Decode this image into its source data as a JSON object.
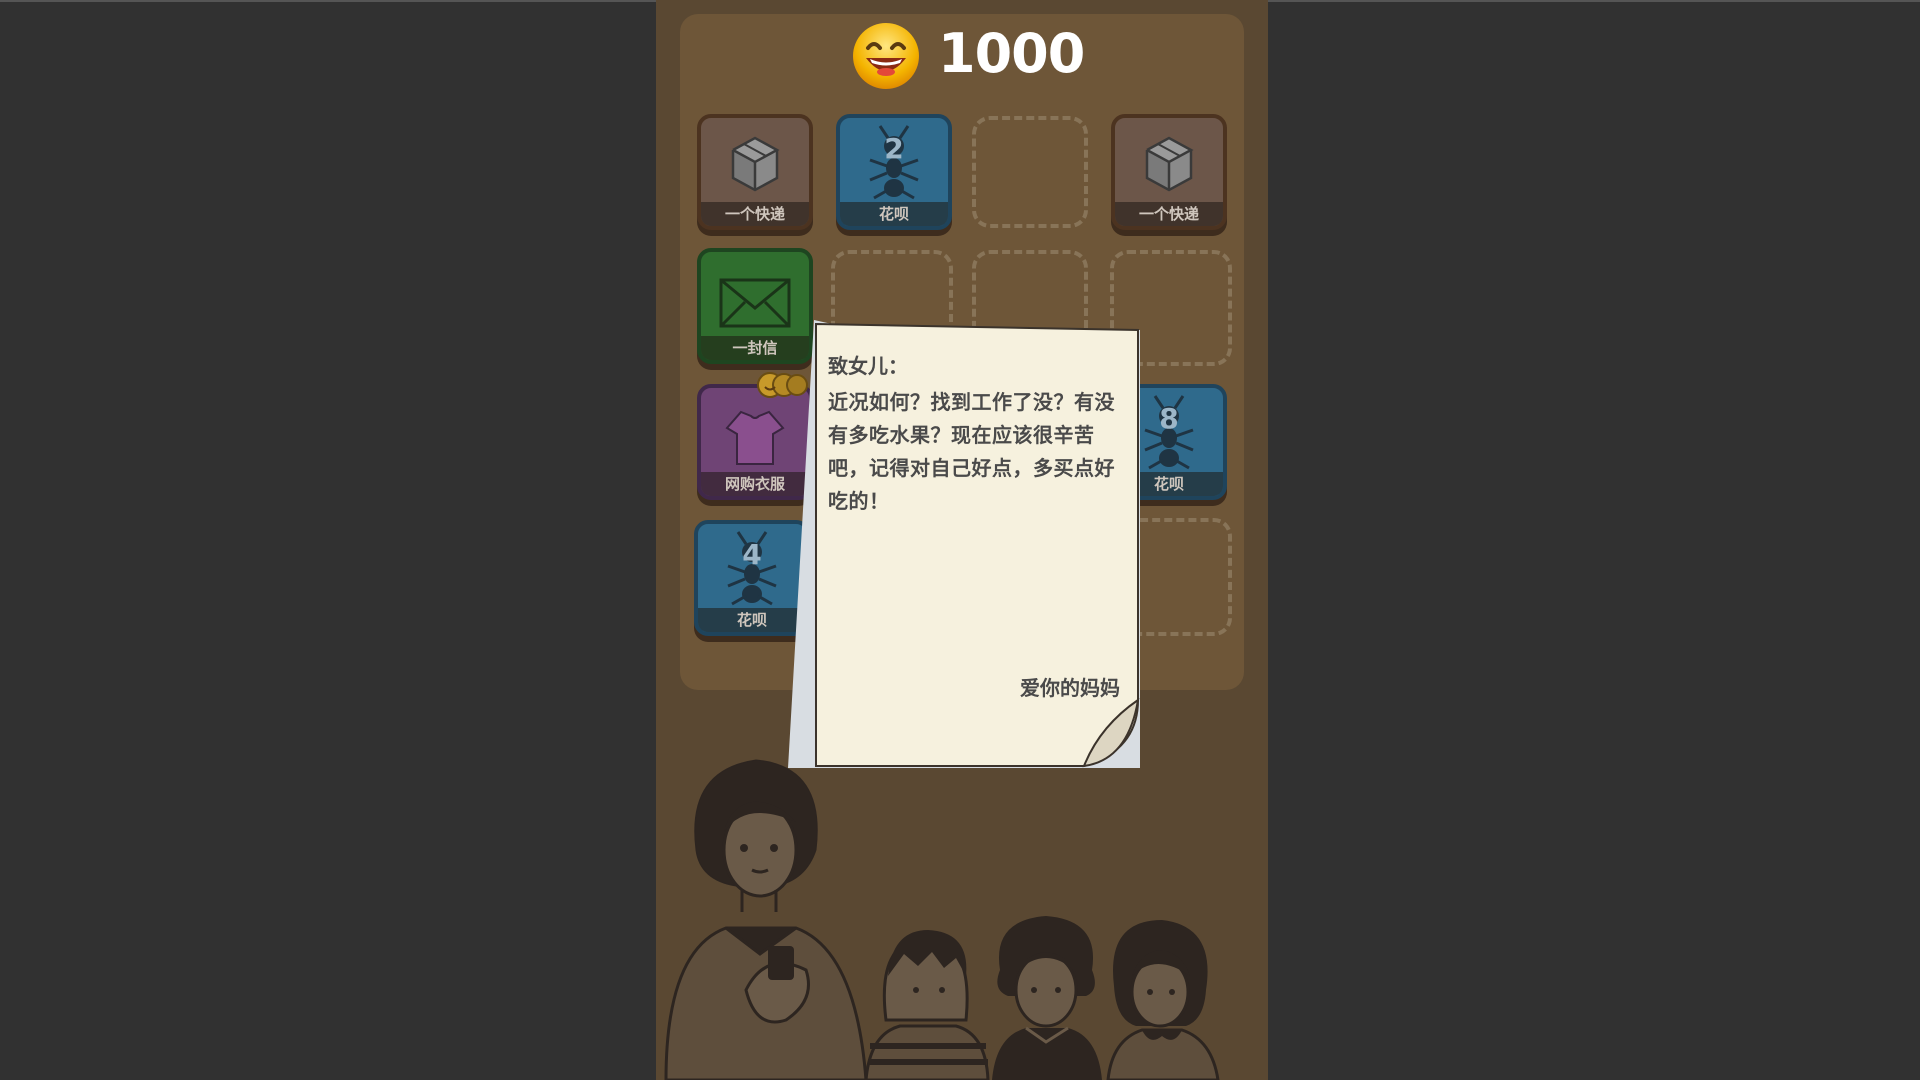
{
  "score": {
    "emoji": "grinning-face",
    "value": "1000"
  },
  "board": {
    "tiles": [
      {
        "id": "express-1",
        "label": "一个快递",
        "color": "brown",
        "level": ""
      },
      {
        "id": "antbei-2",
        "label": "花呗",
        "color": "blue",
        "level": "2"
      },
      {
        "id": "empty-r1c3",
        "label": "",
        "color": "empty",
        "level": ""
      },
      {
        "id": "express-2",
        "label": "一个快递",
        "color": "brown",
        "level": ""
      },
      {
        "id": "letter-tile",
        "label": "一封信",
        "color": "green",
        "level": ""
      },
      {
        "id": "clothes",
        "label": "网购衣服",
        "color": "purple",
        "level": ""
      },
      {
        "id": "antbei-8",
        "label": "花呗",
        "color": "blue",
        "level": "8"
      },
      {
        "id": "antbei-4",
        "label": "花呗",
        "color": "blue",
        "level": "4"
      }
    ]
  },
  "letter": {
    "greeting": "致女儿：",
    "body": "近况如何？找到工作了没？有没有多吃水果？现在应该很辛苦吧，记得对自己好点，多买点好吃的！",
    "signature": "爱你的妈妈"
  },
  "colors": {
    "background": "#313131",
    "game_bg": "#5a4832",
    "board_bg": "#6e5638",
    "paper": "#f6f1de",
    "score_text": "#ffffff"
  }
}
